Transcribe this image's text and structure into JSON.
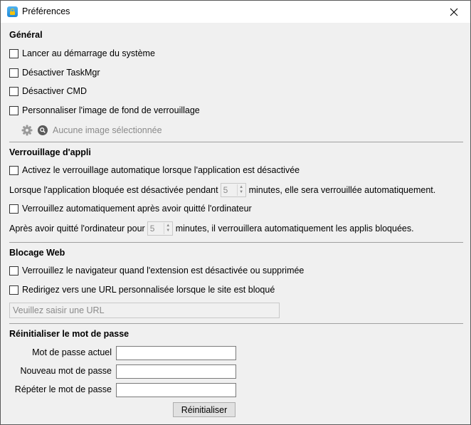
{
  "window": {
    "title": "Préférences",
    "app_icon": "lock-icon",
    "close_icon": "close-icon"
  },
  "general": {
    "title": "Général",
    "options": [
      {
        "label": "Lancer au démarrage du système",
        "checked": false
      },
      {
        "label": "Désactiver TaskMgr",
        "checked": false
      },
      {
        "label": "Désactiver CMD",
        "checked": false
      },
      {
        "label": "Personnaliser l'image de fond de verrouillage",
        "checked": false
      }
    ],
    "image_status": "Aucune image sélectionnée",
    "icons": [
      "gear-icon",
      "search-icon"
    ]
  },
  "app_lock": {
    "title": "Verrouillage d'appli",
    "auto_lock_label": "Activez le verrouillage automatique lorsque l'application est désactivée",
    "auto_lock_checked": false,
    "inactive_prefix": "Lorsque l'application bloquée est désactivée pendant",
    "inactive_minutes": "5",
    "inactive_suffix": "minutes, elle sera verrouillée automatiquement.",
    "leave_lock_label": "Verrouillez automatiquement après avoir quitté l'ordinateur",
    "leave_lock_checked": false,
    "leave_prefix": "Après avoir quitté l'ordinateur pour",
    "leave_minutes": "5",
    "leave_suffix": "minutes, il verrouillera automatiquement les applis bloquées."
  },
  "web_block": {
    "title": "Blocage Web",
    "lock_browser_label": "Verrouillez le navigateur quand l'extension est désactivée ou supprimée",
    "lock_browser_checked": false,
    "redirect_label": "Redirigez vers une URL personnalisée lorsque le site est bloqué",
    "redirect_checked": false,
    "url_placeholder": "Veuillez saisir une URL",
    "url_value": ""
  },
  "password_reset": {
    "title": "Réinitialiser le mot de passe",
    "current_label": "Mot de passe actuel",
    "new_label": "Nouveau mot de passe",
    "repeat_label": "Répéter le mot de passe",
    "current_value": "",
    "new_value": "",
    "repeat_value": "",
    "button_label": "Réinitialiser"
  }
}
